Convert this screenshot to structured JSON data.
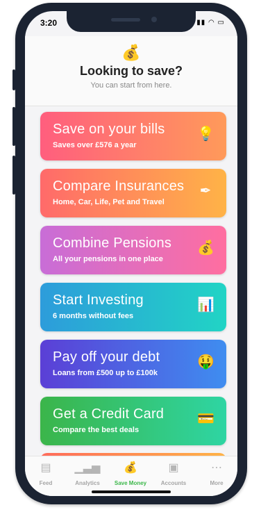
{
  "status": {
    "time": "3:20",
    "icons": "▮▮ ◠ ▭"
  },
  "header": {
    "icon": "💰",
    "title": "Looking to save?",
    "subtitle": "You can start from here."
  },
  "cards": [
    {
      "title": "Save on your bills",
      "subtitle": "Saves over £576 a year",
      "icon": "💡",
      "icon_name": "lightbulb-icon",
      "gradient": [
        "#ff5e7e",
        "#ff9a5a"
      ]
    },
    {
      "title": "Compare Insurances",
      "subtitle": "Home, Car, Life, Pet and Travel",
      "icon": "✒",
      "icon_name": "pen-icon",
      "gradient": [
        "#ff6a6a",
        "#ffb347"
      ]
    },
    {
      "title": "Combine Pensions",
      "subtitle": "All your pensions in one place",
      "icon": "💰",
      "icon_name": "money-bag-icon",
      "gradient": [
        "#c86dd7",
        "#ff6ea0"
      ]
    },
    {
      "title": "Start Investing",
      "subtitle": "6 months without fees",
      "icon": "📊",
      "icon_name": "bar-chart-icon",
      "gradient": [
        "#2d9cdb",
        "#21d4c5"
      ]
    },
    {
      "title": "Pay off your debt",
      "subtitle": "Loans from £500 up to £100k",
      "icon": "🤑",
      "icon_name": "money-face-icon",
      "gradient": [
        "#5b3fd6",
        "#3f8df0"
      ]
    },
    {
      "title": "Get a Credit Card",
      "subtitle": "Compare the best deals",
      "icon": "💳",
      "icon_name": "credit-card-icon",
      "gradient": [
        "#3bb54a",
        "#2ed5a3"
      ]
    }
  ],
  "tabbar": [
    {
      "label": "Feed",
      "icon": "▤",
      "icon_name": "feed-icon",
      "active": false
    },
    {
      "label": "Analytics",
      "icon": "▁▃▅",
      "icon_name": "analytics-icon",
      "active": false
    },
    {
      "label": "Save Money",
      "icon": "💰",
      "icon_name": "money-bag-icon",
      "active": true
    },
    {
      "label": "Accounts",
      "icon": "▣",
      "icon_name": "accounts-icon",
      "active": false
    },
    {
      "label": "More",
      "icon": "⋯",
      "icon_name": "more-icon",
      "active": false
    }
  ],
  "colors": {
    "active_tab": "#3cb84a",
    "phone_frame": "#1b2332"
  }
}
